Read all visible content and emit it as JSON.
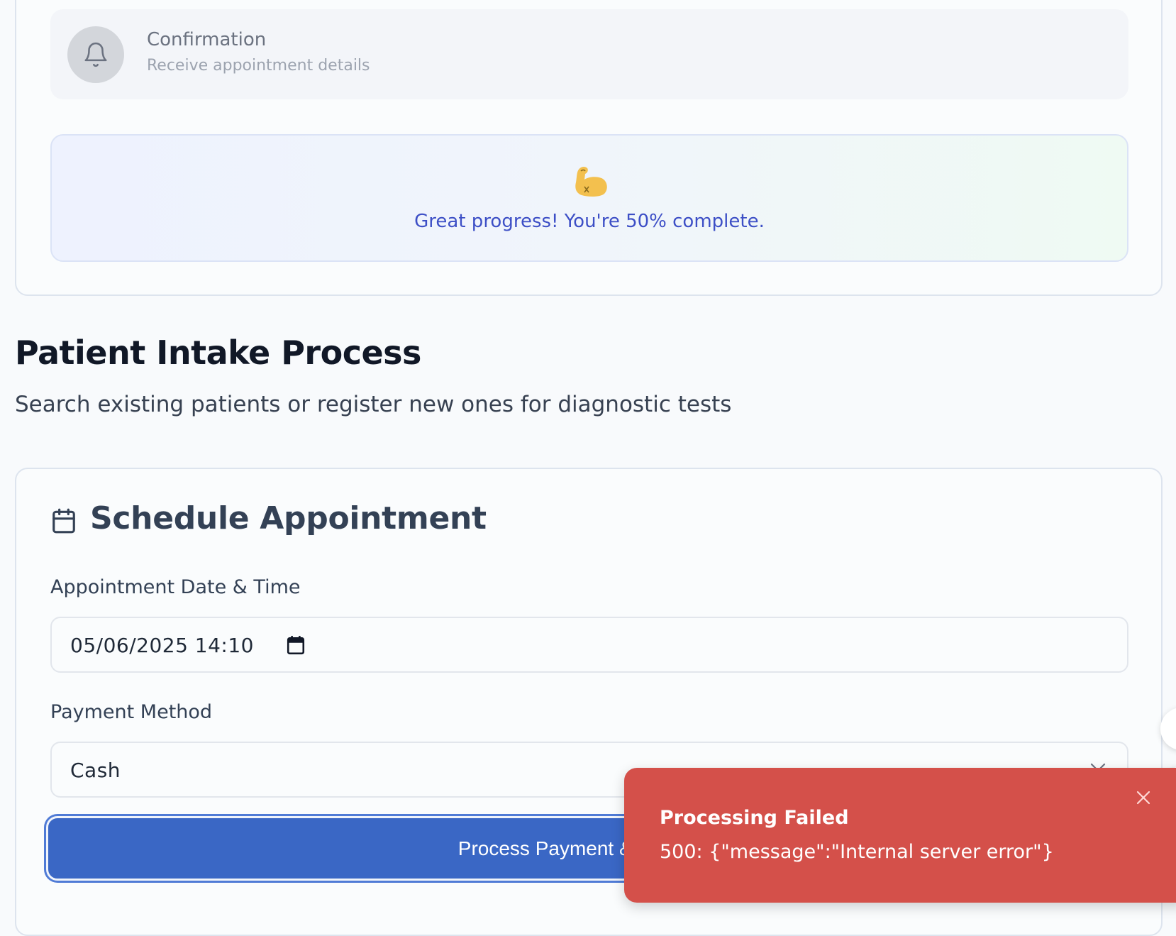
{
  "steps": [
    {
      "title": "Confirmation",
      "subtitle": "Receive appointment details",
      "icon": "bell-icon"
    }
  ],
  "progress": {
    "emoji": "flexed-biceps",
    "message": "Great progress! You're 50% complete.",
    "percent": 50
  },
  "page": {
    "title": "Patient Intake Process",
    "subtitle": "Search existing patients or register new ones for diagnostic tests"
  },
  "schedule": {
    "title": "Schedule Appointment",
    "icon": "calendar-icon",
    "datetime_label": "Appointment Date & Time",
    "datetime_value": "05/06/2025 14:10",
    "payment_label": "Payment Method",
    "payment_value": "Cash",
    "submit_label": "Process Payment & Schedule"
  },
  "toast": {
    "title": "Processing Failed",
    "message": "500: {\"message\":\"Internal server error\"}"
  },
  "colors": {
    "primary": "#3a67c5",
    "error": "#d4504a",
    "progress_text": "#3d4fc6"
  }
}
